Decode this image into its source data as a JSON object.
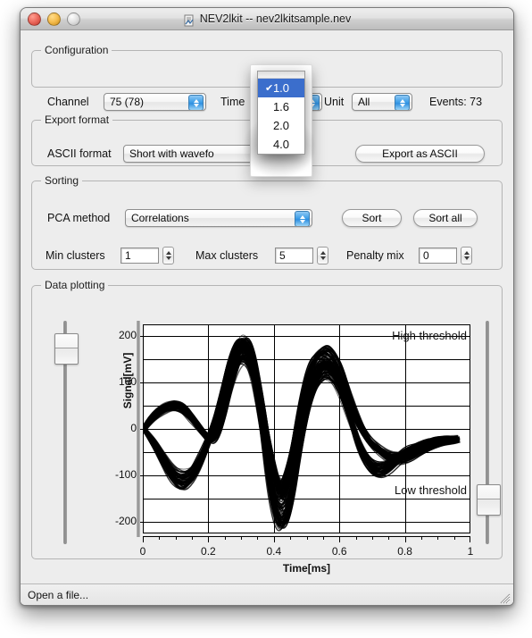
{
  "window": {
    "title": "NEV2lkit -- nev2lkitsample.nev",
    "doc_icon": "document-icon",
    "controls": {
      "close": "close-button",
      "minimize": "minimize-button",
      "zoom": "zoom-button"
    }
  },
  "configuration": {
    "legend": "Configuration",
    "channel_label": "Channel",
    "channel_value": "75 (78)",
    "time_label": "Time",
    "time_value": "1.0",
    "unit_label": "Unit",
    "unit_value": "All",
    "events_label": "Events: 73"
  },
  "time_menu": {
    "open": true,
    "items": [
      {
        "label": "1.0",
        "checked": true
      },
      {
        "label": "1.6",
        "checked": false
      },
      {
        "label": "2.0",
        "checked": false
      },
      {
        "label": "4.0",
        "checked": false
      }
    ],
    "check_glyph": "✔",
    "highlight_color": "#3b6ecc"
  },
  "export_format": {
    "legend": "Export format",
    "ascii_label": "ASCII format",
    "ascii_value": "Short with wavefo",
    "export_button": "Export as ASCII"
  },
  "sorting": {
    "legend": "Sorting",
    "pca_label": "PCA method",
    "pca_value": "Correlations",
    "sort_button": "Sort",
    "sort_all_button": "Sort all",
    "min_clusters_label": "Min clusters",
    "min_clusters_value": "1",
    "max_clusters_label": "Max clusters",
    "max_clusters_value": "5",
    "penalty_mix_label": "Penalty mix",
    "penalty_mix_value": "0"
  },
  "data_plotting": {
    "legend": "Data plotting",
    "high_threshold_label": "High threshold",
    "low_threshold_label": "Low threshold",
    "left_slider": "high-threshold-slider",
    "right_slider": "low-threshold-slider"
  },
  "statusbar": {
    "text": "Open a file...",
    "grip": "resize-grip"
  },
  "chart_data": {
    "type": "line",
    "title": "",
    "xlabel": "Time[ms]",
    "ylabel": "Signal[mV]",
    "xlim": [
      0,
      1
    ],
    "ylim": [
      -225,
      225
    ],
    "xticks": [
      0,
      0.2,
      0.4,
      0.6,
      0.8,
      1
    ],
    "xtick_labels": [
      "0",
      "0.2",
      "0.4",
      "0.6",
      "0.8",
      "1"
    ],
    "yticks": [
      -200,
      -100,
      0,
      100,
      200
    ],
    "ytick_labels": [
      "-200",
      "-100",
      "0",
      "100",
      "200"
    ],
    "ygrid_values": [
      200,
      150,
      100,
      50,
      0,
      -50,
      -100,
      -150,
      -200
    ],
    "xgrid_values": [
      0,
      0.2,
      0.4,
      0.6,
      0.8,
      1
    ],
    "grid": true,
    "legend_position": "none",
    "annotations": [
      {
        "text": "High threshold",
        "x": 0.97,
        "y": 185,
        "align": "right"
      },
      {
        "text": "Low threshold",
        "x": 0.97,
        "y": -150,
        "align": "right"
      }
    ],
    "series": [
      {
        "name": "spike-waveform-overlay",
        "n_traces": 73,
        "x": [
          0.0,
          0.03,
          0.06,
          0.09,
          0.12,
          0.15,
          0.18,
          0.21,
          0.24,
          0.27,
          0.3,
          0.33,
          0.36,
          0.39,
          0.42,
          0.45,
          0.48,
          0.51,
          0.54,
          0.57,
          0.6,
          0.63,
          0.66,
          0.69,
          0.72,
          0.75,
          0.78,
          0.81,
          0.84,
          0.87,
          0.9,
          0.93,
          0.96
        ],
        "values": [
          0,
          25,
          42,
          50,
          45,
          22,
          -5,
          -30,
          10,
          110,
          172,
          160,
          60,
          -60,
          -150,
          -80,
          40,
          120,
          148,
          150,
          118,
          60,
          10,
          -25,
          -45,
          -58,
          -62,
          -58,
          -48,
          -38,
          -30,
          -26,
          -24
        ]
      },
      {
        "name": "spike-waveform-overlay-lower",
        "n_traces": 73,
        "x": [
          0.0,
          0.03,
          0.06,
          0.09,
          0.12,
          0.15,
          0.18,
          0.21,
          0.24,
          0.27,
          0.3,
          0.33,
          0.36,
          0.39,
          0.42,
          0.45,
          0.48,
          0.51,
          0.54,
          0.57,
          0.6,
          0.63,
          0.66,
          0.69,
          0.72,
          0.75,
          0.78,
          0.81,
          0.84,
          0.87,
          0.9,
          0.93,
          0.96
        ],
        "values": [
          0,
          -25,
          -60,
          -95,
          -112,
          -100,
          -60,
          -10,
          60,
          140,
          176,
          150,
          30,
          -130,
          -196,
          -160,
          -30,
          70,
          120,
          128,
          95,
          30,
          -35,
          -75,
          -88,
          -80,
          -62,
          -48,
          -36,
          -28,
          -22,
          -20,
          -20
        ]
      }
    ]
  }
}
